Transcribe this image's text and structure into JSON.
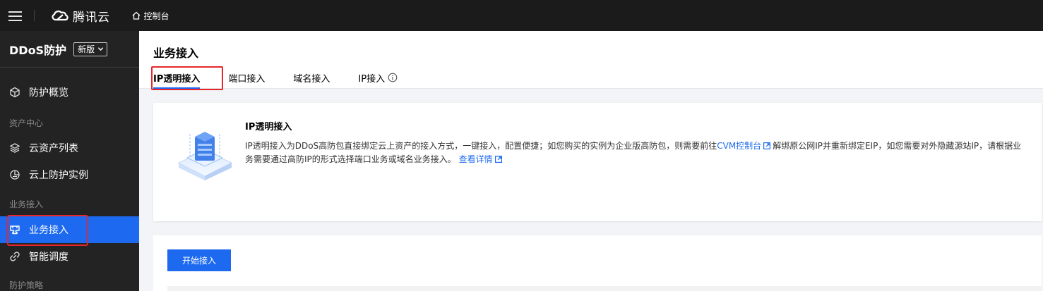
{
  "topbar": {
    "logo_text": "腾讯云",
    "console_label": "控制台",
    "icons": [
      "hamburger-icon",
      "tencent-cloud-logo",
      "home-icon"
    ]
  },
  "sidebar": {
    "title": "DDoS防护",
    "version": "新版",
    "items": [
      {
        "label": "防护概览",
        "icon": "cube-icon"
      },
      {
        "label": "云资产列表",
        "icon": "layers-icon"
      },
      {
        "label": "云上防护实例",
        "icon": "shield-cloud-icon"
      },
      {
        "label": "业务接入",
        "icon": "plug-icon",
        "active": true
      },
      {
        "label": "智能调度",
        "icon": "link-icon"
      }
    ],
    "groups": [
      "资产中心",
      "业务接入",
      "防护策略"
    ]
  },
  "main": {
    "title": "业务接入",
    "tabs": [
      {
        "label": "IP透明接入",
        "active": true
      },
      {
        "label": "端口接入"
      },
      {
        "label": "域名接入"
      },
      {
        "label": "IP接入"
      }
    ],
    "intro": {
      "title": "IP透明接入",
      "desc_part1": "IP透明接入为DDoS高防包直接绑定云上资产的接入方式，一键接入，配置便捷；如您购买的实例为企业版高防包，则需要前往",
      "cvm_link": "CVM控制台",
      "desc_part2": "解绑原公网IP并重新绑定EIP，如您需要对外隐藏源站IP，请根据业务需要通过高防IP的形式选择端口业务或域名业务接入。",
      "detail_link": "查看详情"
    },
    "start_button": "开始接入"
  },
  "colors": {
    "accent": "#1d6af0",
    "highlight": "#e5262c",
    "topbar": "#1b1b1b",
    "sidebar": "#232323"
  }
}
